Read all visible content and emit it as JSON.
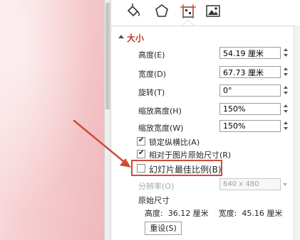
{
  "pane": {
    "tabs": [
      {
        "icon": "fill-bucket-icon"
      },
      {
        "icon": "pentagon-icon"
      },
      {
        "icon": "size-position-icon"
      },
      {
        "icon": "picture-icon"
      }
    ],
    "section_title": "大小",
    "height_label": "高度(E)",
    "height_value": "54.19 厘米",
    "width_label": "宽度(D)",
    "width_value": "67.73 厘米",
    "rotation_label": "旋转(T)",
    "rotation_value": "0°",
    "scale_height_label": "缩放高度(H)",
    "scale_height_value": "150%",
    "scale_width_label": "缩放宽度(W)",
    "scale_width_value": "150%",
    "lock_aspect_label": "锁定纵横比(A)",
    "lock_aspect_checked": true,
    "relative_size_label": "相对于图片原始尺寸(R)",
    "relative_size_checked": true,
    "best_scale_label": "幻灯片最佳比例(B)",
    "best_scale_checked": false,
    "resolution_label": "分辨率(O)",
    "resolution_value": "640 x 480",
    "original_size_title": "原始尺寸",
    "original_size_text": "高度:  36.12 厘米    宽度:  45.16 厘米",
    "reset_label": "重设(S)"
  },
  "colors": {
    "accent": "#c0392b",
    "annotation": "#d04a3a"
  }
}
